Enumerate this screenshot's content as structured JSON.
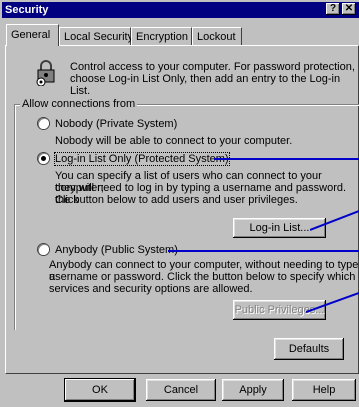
{
  "window": {
    "title": "Security",
    "help_button": "?",
    "close_button": "✕"
  },
  "tabs": [
    {
      "label": "General"
    },
    {
      "label": "Local Security"
    },
    {
      "label": "Encryption"
    },
    {
      "label": "Lockout"
    }
  ],
  "intro": {
    "line1": "Control access to your computer.  For password protection,",
    "line2": "choose Log-in List Only, then add an entry to the Log-in List."
  },
  "group": {
    "label": "Allow connections from"
  },
  "options": {
    "nobody": {
      "label": "Nobody (Private System)",
      "desc1": "Nobody will be able to connect to your computer."
    },
    "loginlist": {
      "label": "Log-in List Only (Protected System)",
      "desc1": "You can specify a list of users who can connect to your computer;",
      "desc2": "they will need to log in by typing a username and password.  Click",
      "desc3": "the button below to add users and user privileges."
    },
    "anybody": {
      "label": "Anybody (Public System)",
      "desc1": "Anybody can connect to your computer, without needing to type a",
      "desc2": "username or password.  Click the button below to specify which",
      "desc3": "services and security options are allowed."
    }
  },
  "buttons": {
    "login_list": "Log-in List...",
    "public_privileges": "Public Privileges...",
    "defaults": "Defaults",
    "ok": "OK",
    "cancel": "Cancel",
    "apply": "Apply",
    "help": "Help"
  },
  "colors": {
    "accent": "#0000c8",
    "titlebar": "#000080",
    "face": "#c0c0c0"
  }
}
